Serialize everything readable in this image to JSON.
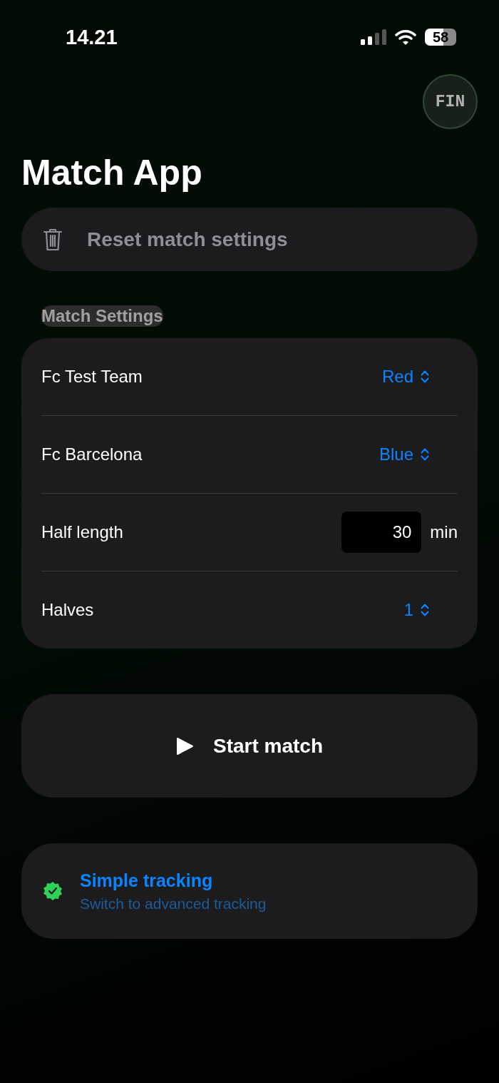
{
  "status_bar": {
    "time": "14.21",
    "battery": "58"
  },
  "fin_button": {
    "label": "FIN"
  },
  "title": "Match App",
  "reset_button": {
    "label": "Reset match settings"
  },
  "section_header": "Match Settings",
  "settings": [
    {
      "kind": "picker",
      "label": "Fc Test Team",
      "value": "Red"
    },
    {
      "kind": "picker",
      "label": "Fc Barcelona",
      "value": "Blue"
    },
    {
      "kind": "number",
      "label": "Half length",
      "value": "30",
      "unit": "min"
    },
    {
      "kind": "picker",
      "label": "Halves",
      "value": "1"
    }
  ],
  "start_button": {
    "label": "Start match"
  },
  "tracking": {
    "title": "Simple tracking",
    "subtitle": "Switch to advanced tracking"
  }
}
